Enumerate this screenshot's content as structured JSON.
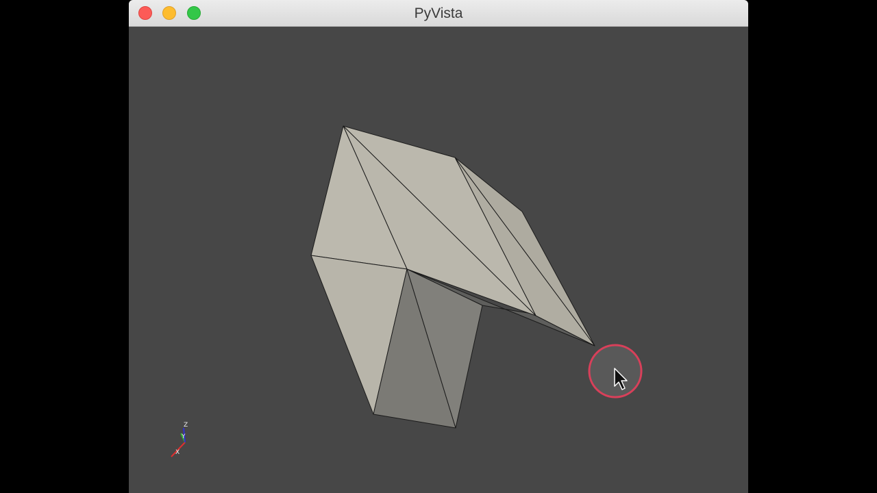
{
  "window": {
    "title": "PyVista"
  },
  "viewport": {
    "background_color": "#474747",
    "mesh_color": "#bab7ac",
    "shade_color": "#7b7a75",
    "edge_color": "#1a1a1a"
  },
  "axes_widget": {
    "x_label": "X",
    "y_label": "Y",
    "z_label": "Z",
    "x_color": "#e03030",
    "y_color": "#30b030",
    "z_color": "#3030d0"
  },
  "cursor": {
    "highlight_color": "#d8405a",
    "icon": "arrow-cursor-icon"
  }
}
